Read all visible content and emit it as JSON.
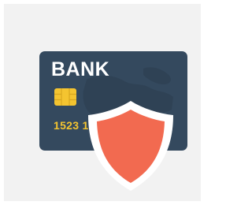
{
  "card": {
    "bank_name": "BANK",
    "card_number_partial": "1523  15",
    "chip_icon": "sim-chip-icon",
    "map_decoration": "world-map",
    "shield_icon": "security-shield-icon"
  },
  "colors": {
    "background": "#f2f2f2",
    "card": "#34495e",
    "card_map": "#2f4255",
    "chip": "#f4c430",
    "number": "#f4c430",
    "shield_fill": "#f26a50",
    "shield_border": "#ffffff"
  }
}
